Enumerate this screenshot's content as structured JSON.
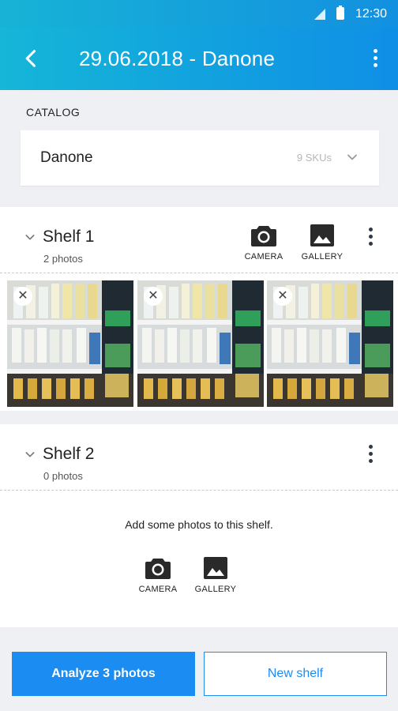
{
  "status": {
    "time": "12:30"
  },
  "appbar": {
    "title": "29.06.2018 - Danone"
  },
  "catalog": {
    "label": "CATALOG",
    "name": "Danone",
    "skus": "9 SKUs"
  },
  "shelves": [
    {
      "name": "Shelf 1",
      "count": "2 photos",
      "camera_label": "CAMERA",
      "gallery_label": "GALLERY"
    },
    {
      "name": "Shelf 2",
      "count": "0 photos",
      "empty_message": "Add some photos to this shelf.",
      "camera_label": "CAMERA",
      "gallery_label": "GALLERY"
    }
  ],
  "actions": {
    "analyze_label": "Analyze 3 photos",
    "new_shelf_label": "New shelf"
  },
  "colors": {
    "accent": "#1a8cf2",
    "appbar_start": "#15b6d7",
    "appbar_end": "#0f8fe6"
  },
  "icons": [
    "back-arrow-icon",
    "more-vert-icon",
    "chevron-down-icon",
    "camera-icon",
    "gallery-icon",
    "close-icon"
  ]
}
